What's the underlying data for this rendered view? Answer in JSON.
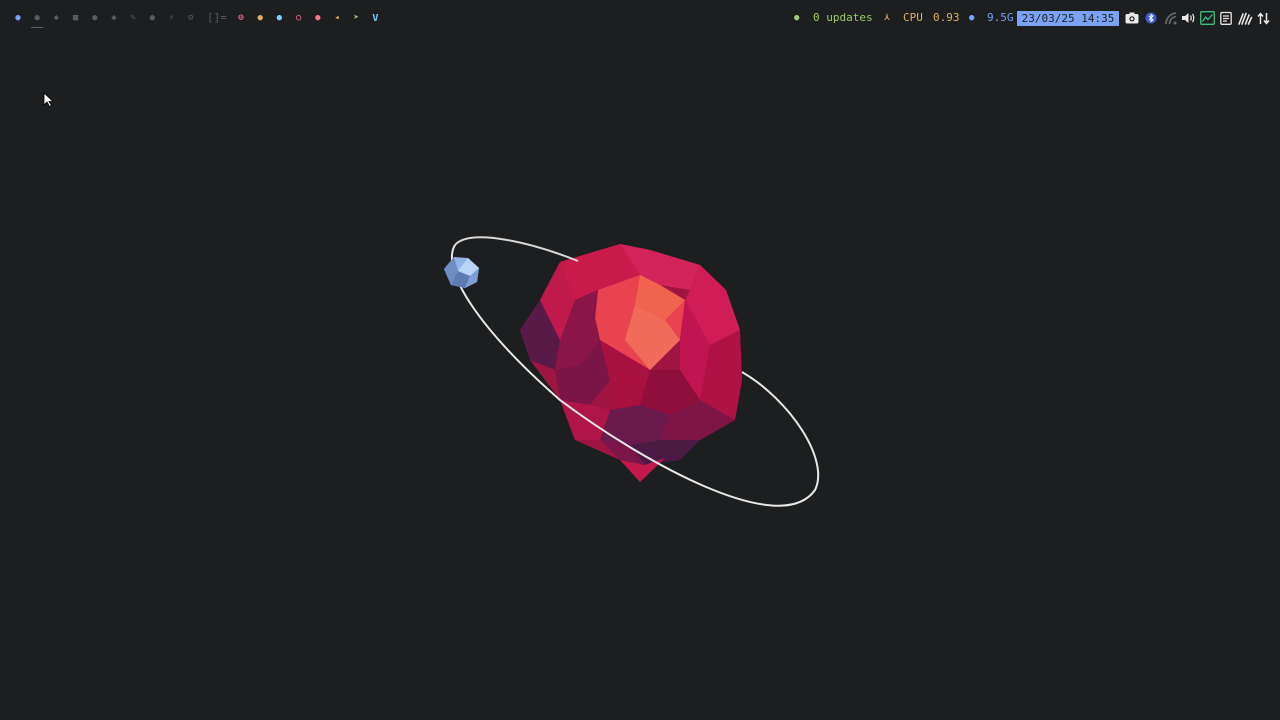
{
  "bar": {
    "updates_text": "0 updates",
    "cpu_label": "CPU",
    "cpu_value": "0.93",
    "mem_value": "9.5G",
    "datetime": "23/03/25 14:35",
    "layout_glyph": "[]=",
    "workspaces": [
      {
        "icon": "circle-icon",
        "glyph": "●",
        "color": "#7aa2f7"
      },
      {
        "icon": "circle-dim-icon",
        "glyph": "●",
        "color": "#565c64"
      },
      {
        "icon": "shield-icon",
        "glyph": "◆",
        "color": "#565c64"
      },
      {
        "icon": "square-icon",
        "glyph": "■",
        "color": "#565c64"
      },
      {
        "icon": "dot-icon",
        "glyph": "●",
        "color": "#565c64"
      },
      {
        "icon": "shield2-icon",
        "glyph": "◆",
        "color": "#565c64"
      },
      {
        "icon": "wrench-icon",
        "glyph": "✎",
        "color": "#565c64"
      },
      {
        "icon": "drop-icon",
        "glyph": "●",
        "color": "#565c64"
      },
      {
        "icon": "bolt-icon",
        "glyph": "⚡",
        "color": "#565c64"
      },
      {
        "icon": "gear-icon",
        "glyph": "⚙",
        "color": "#565c64"
      }
    ],
    "apps": [
      {
        "icon": "stop-icon",
        "glyph": "⊖",
        "color": "#f7768e"
      },
      {
        "icon": "firefox-icon",
        "glyph": "●",
        "color": "#e0af68"
      },
      {
        "icon": "chromium-icon",
        "glyph": "●",
        "color": "#7dcfff"
      },
      {
        "icon": "opera-icon",
        "glyph": "○",
        "color": "#f7768e"
      },
      {
        "icon": "git-icon",
        "glyph": "●",
        "color": "#f7768e"
      },
      {
        "icon": "speaker-icon",
        "glyph": "◂",
        "color": "#e0af68"
      },
      {
        "icon": "telegram-icon",
        "glyph": "➤",
        "color": "#9ece6a"
      },
      {
        "icon": "vim-icon",
        "glyph": "V",
        "color": "#7dcfff"
      }
    ]
  },
  "colors": {
    "background": "#1c1e1f",
    "accent": "#7aa2f7",
    "green": "#9ece6a",
    "yellow": "#e0af68",
    "planet": "#c8184a"
  }
}
